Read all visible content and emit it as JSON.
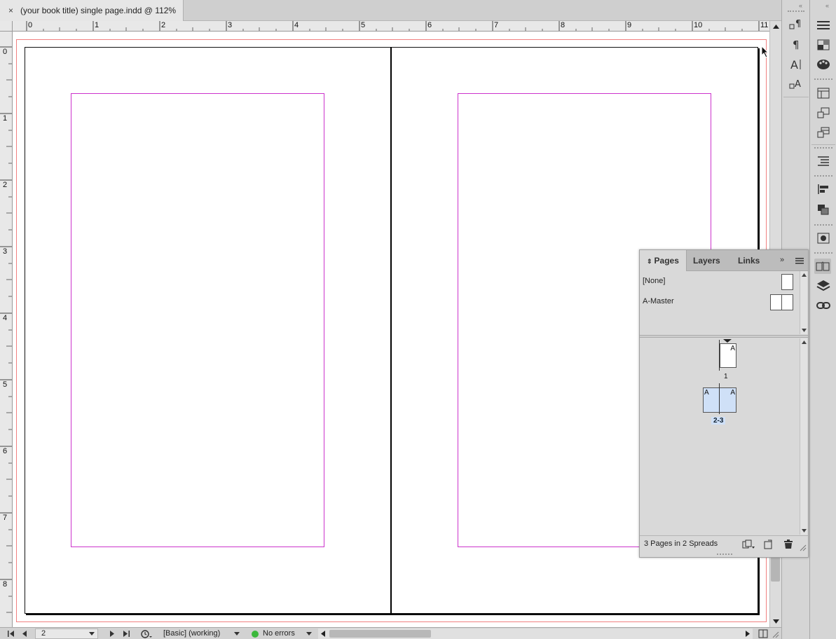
{
  "document": {
    "tab_title": "(your book title) single page.indd @ 112%",
    "close_glyph": "×"
  },
  "rulers": {
    "horizontal_labels": [
      "0",
      "1",
      "2",
      "3",
      "4",
      "5",
      "6",
      "7",
      "8",
      "9",
      "10",
      "11"
    ],
    "vertical_labels": [
      "0",
      "1",
      "2",
      "3",
      "4",
      "5",
      "6",
      "7",
      "8"
    ]
  },
  "statusbar": {
    "page_number": "2",
    "preflight_profile": "[Basic] (working)",
    "preflight_status": "No errors",
    "status_color": "#3cb83c"
  },
  "pages_panel": {
    "tabs": [
      "Pages",
      "Layers",
      "Links"
    ],
    "masters": [
      {
        "label": "[None]"
      },
      {
        "label": "A-Master"
      }
    ],
    "page_thumbs": [
      {
        "label": "1",
        "master_prefix": "A"
      },
      {
        "label": "2-3",
        "master_prefix_left": "A",
        "master_prefix_right": "A",
        "selected": true
      }
    ],
    "footer_text": "3 Pages in 2 Spreads"
  },
  "colors": {
    "margin_guide": "#cc33cc",
    "bleed_guide": "#f08080",
    "selection": "#cfe0f7"
  },
  "icons": {
    "dock1": [
      "paragraph-style-icon",
      "paragraph-icon",
      "character-icon",
      "character-style-icon"
    ],
    "dock2": [
      "menu-icon",
      "swatches-icon",
      "color-icon",
      "table-icon",
      "object-styles-icon",
      "cell-styles-icon",
      "text-wrap-icon",
      "align-icon",
      "pathfinder-icon",
      "effects-icon",
      "pages-icon",
      "layers-icon",
      "links-icon"
    ]
  }
}
